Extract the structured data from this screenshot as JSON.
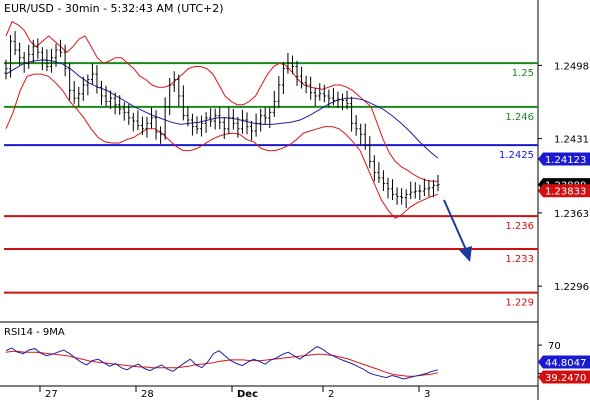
{
  "header": {
    "title": "EUR/USD - 30min - 5:32:43 AM (UTC+2)"
  },
  "colors": {
    "green_line": "#1a8a1a",
    "blue_line": "#1a1ad0",
    "red_line": "#d01010",
    "bollinger": "#d81818",
    "ma": "#2020a0",
    "candle": "#000000",
    "price_tag_bg": "#000000",
    "blue_tag_bg": "#1a1ad0",
    "red_tag_bg": "#d01010",
    "arrow": "#1a3aa0"
  },
  "chart_data": [
    {
      "type": "candlestick",
      "title": "EUR/USD - 30min - 5:32:43 AM (UTC+2)",
      "ylim": [
        1.2265,
        1.2545
      ],
      "y_ticks": [
        "1.2498",
        "1.2431",
        "1.2363",
        "1.2296"
      ],
      "x_ticks": [
        "27",
        "28",
        "Dec",
        "2",
        "3"
      ],
      "levels": [
        {
          "label": "1.25",
          "value": 1.25,
          "color": "green"
        },
        {
          "label": "1.246",
          "value": 1.246,
          "color": "green"
        },
        {
          "label": "1.2425",
          "value": 1.2425,
          "color": "blue"
        },
        {
          "label": "1.236",
          "value": 1.236,
          "color": "red"
        },
        {
          "label": "1.233",
          "value": 1.233,
          "color": "red"
        },
        {
          "label": "1.229",
          "value": 1.229,
          "color": "red"
        }
      ],
      "price_tags": [
        {
          "label": "1.24123",
          "value": 1.24123,
          "style": "blue"
        },
        {
          "label": "1.23889",
          "value": 1.23889,
          "style": "black"
        },
        {
          "label": "1.23833",
          "value": 1.23833,
          "style": "red"
        }
      ],
      "close_series": [
        1.2495,
        1.252,
        1.2512,
        1.2505,
        1.25,
        1.2508,
        1.2515,
        1.251,
        1.2503,
        1.2497,
        1.2505,
        1.2512,
        1.251,
        1.2495,
        1.2475,
        1.2468,
        1.2472,
        1.248,
        1.2485,
        1.249,
        1.2478,
        1.247,
        1.2465,
        1.2468,
        1.2462,
        1.2458,
        1.2455,
        1.245,
        1.2447,
        1.2443,
        1.244,
        1.2445,
        1.245,
        1.2437,
        1.2435,
        1.246,
        1.248,
        1.2485,
        1.247,
        1.2452,
        1.2448,
        1.2442,
        1.244,
        1.2445,
        1.245,
        1.2447,
        1.2452,
        1.2446,
        1.244,
        1.245,
        1.2445,
        1.244,
        1.2448,
        1.2442,
        1.2438,
        1.2445,
        1.2452,
        1.245,
        1.2455,
        1.2465,
        1.248,
        1.2495,
        1.25,
        1.2497,
        1.2488,
        1.2482,
        1.248,
        1.2473,
        1.247,
        1.2472,
        1.247,
        1.2468,
        1.2466,
        1.2467,
        1.2466,
        1.2463,
        1.2445,
        1.244,
        1.2435,
        1.2425,
        1.241,
        1.24,
        1.2395,
        1.239,
        1.2385,
        1.238,
        1.2378,
        1.2377,
        1.238,
        1.2382,
        1.2383,
        1.2383,
        1.2385,
        1.2386,
        1.2388,
        1.2389
      ],
      "bollinger_upper": [
        1.2525,
        1.2538,
        1.2535,
        1.253,
        1.252,
        1.2515,
        1.252,
        1.2525,
        1.252,
        1.2515,
        1.251,
        1.2515,
        1.2522,
        1.2525,
        1.2515,
        1.2505,
        1.25,
        1.2502,
        1.2505,
        1.2505,
        1.25,
        1.2495,
        1.2488,
        1.2485,
        1.248,
        1.2478,
        1.2478,
        1.248,
        1.2485,
        1.249,
        1.2495,
        1.2497,
        1.2497,
        1.2495,
        1.249,
        1.248,
        1.247,
        1.2465,
        1.2462,
        1.2462,
        1.2465,
        1.247,
        1.248,
        1.249,
        1.2497,
        1.25,
        1.2498,
        1.2492,
        1.2485,
        1.248,
        1.2478,
        1.2477,
        1.2476,
        1.2478,
        1.248,
        1.248,
        1.2478,
        1.2475,
        1.247,
        1.2465,
        1.246,
        1.2445,
        1.243,
        1.2418,
        1.241,
        1.2405,
        1.2402,
        1.2398,
        1.2395,
        1.2393,
        1.2392,
        1.2392
      ],
      "bollinger_lower": [
        1.244,
        1.2455,
        1.2475,
        1.2488,
        1.249,
        1.249,
        1.2488,
        1.2482,
        1.2475,
        1.2465,
        1.2458,
        1.245,
        1.244,
        1.2432,
        1.2428,
        1.2427,
        1.2427,
        1.243,
        1.2432,
        1.2436,
        1.244,
        1.244,
        1.2436,
        1.243,
        1.2424,
        1.242,
        1.242,
        1.2422,
        1.2426,
        1.243,
        1.2433,
        1.2435,
        1.2436,
        1.2435,
        1.243,
        1.2428,
        1.2422,
        1.242,
        1.242,
        1.2422,
        1.2425,
        1.243,
        1.2436,
        1.2438,
        1.244,
        1.2442,
        1.2442,
        1.244,
        1.2435,
        1.2428,
        1.242,
        1.2405,
        1.239,
        1.2375,
        1.2365,
        1.2358,
        1.2362,
        1.2368,
        1.2372,
        1.2375,
        1.2378,
        1.238
      ],
      "ma_series": [
        1.249,
        1.2495,
        1.25,
        1.2502,
        1.2503,
        1.2502,
        1.25,
        1.2495,
        1.2488,
        1.2482,
        1.2478,
        1.2475,
        1.247,
        1.2465,
        1.246,
        1.2456,
        1.2452,
        1.2449,
        1.2446,
        1.2444,
        1.2445,
        1.2446,
        1.2448,
        1.245,
        1.245,
        1.2449,
        1.2447,
        1.2445,
        1.2444,
        1.2444,
        1.2445,
        1.2446,
        1.2448,
        1.2452,
        1.2457,
        1.2462,
        1.2466,
        1.2468,
        1.2468,
        1.2466,
        1.2462,
        1.2458,
        1.2452,
        1.2445,
        1.2437,
        1.2428,
        1.242,
        1.2413
      ],
      "annotation": "projected downward arrow"
    },
    {
      "type": "line",
      "title": "RSI14 - 9MA",
      "price_tags": [
        {
          "label": "44.8047",
          "style": "blue"
        },
        {
          "label": "39.2470",
          "style": "red"
        }
      ],
      "rsi": [
        62,
        66,
        60,
        58,
        63,
        65,
        59,
        55,
        57,
        60,
        63,
        58,
        52,
        46,
        42,
        48,
        50,
        45,
        40,
        44,
        38,
        35,
        40,
        43,
        37,
        34,
        38,
        42,
        36,
        33,
        39,
        45,
        50,
        42,
        38,
        46,
        58,
        62,
        55,
        48,
        44,
        41,
        46,
        50,
        47,
        43,
        49,
        52,
        57,
        60,
        55,
        50,
        56,
        62,
        68,
        64,
        58,
        54,
        50,
        47,
        44,
        40,
        36,
        31,
        28,
        26,
        24,
        27,
        25,
        22,
        24,
        26,
        28,
        30,
        33,
        35
      ],
      "ma9": [
        60,
        61,
        61,
        60,
        60,
        60,
        59,
        58,
        57,
        56,
        55,
        53,
        51,
        49,
        47,
        46,
        45,
        44,
        43,
        42,
        41,
        40,
        39,
        39,
        38,
        38,
        38,
        38,
        38,
        39,
        40,
        42,
        43,
        44,
        45,
        47,
        48,
        49,
        49,
        49,
        48,
        48,
        48,
        49,
        50,
        51,
        52,
        53,
        54,
        55,
        56,
        57,
        57,
        56,
        55,
        53,
        51,
        48,
        45,
        42,
        39,
        36,
        33,
        30,
        28,
        27,
        26,
        26,
        27,
        28,
        29,
        31
      ]
    }
  ]
}
